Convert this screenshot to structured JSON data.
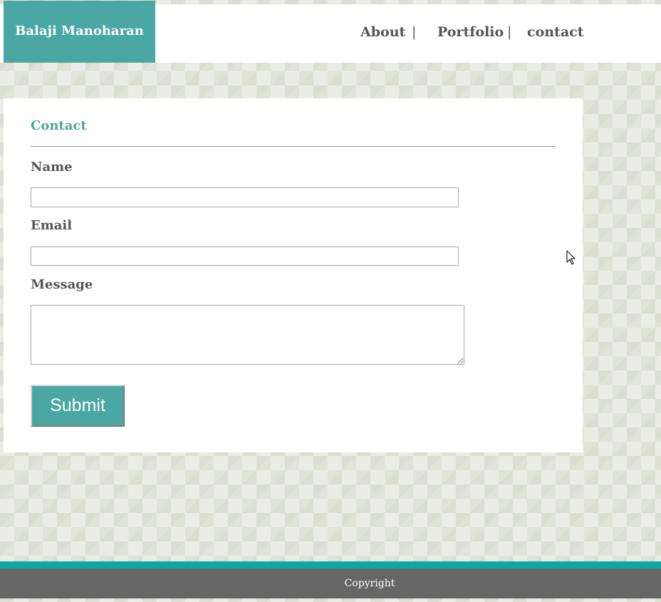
{
  "header": {
    "brand": "Balaji Manoharan",
    "nav": [
      {
        "label": "About"
      },
      {
        "label": "Portfolio"
      },
      {
        "label": "contact"
      }
    ],
    "separator": "|"
  },
  "contact_form": {
    "title": "Contact",
    "fields": {
      "name": {
        "label": "Name",
        "value": ""
      },
      "email": {
        "label": "Email",
        "value": ""
      },
      "message": {
        "label": "Message",
        "value": ""
      }
    },
    "submit_label": "Submit"
  },
  "footer": {
    "text": "Copyright"
  },
  "colors": {
    "accent": "#4aa7a3",
    "footer_stripe": "#0aa9a7",
    "footer_bg": "#666666",
    "text": "#555555"
  },
  "icons": {
    "cursor": "mouse-pointer-icon"
  }
}
